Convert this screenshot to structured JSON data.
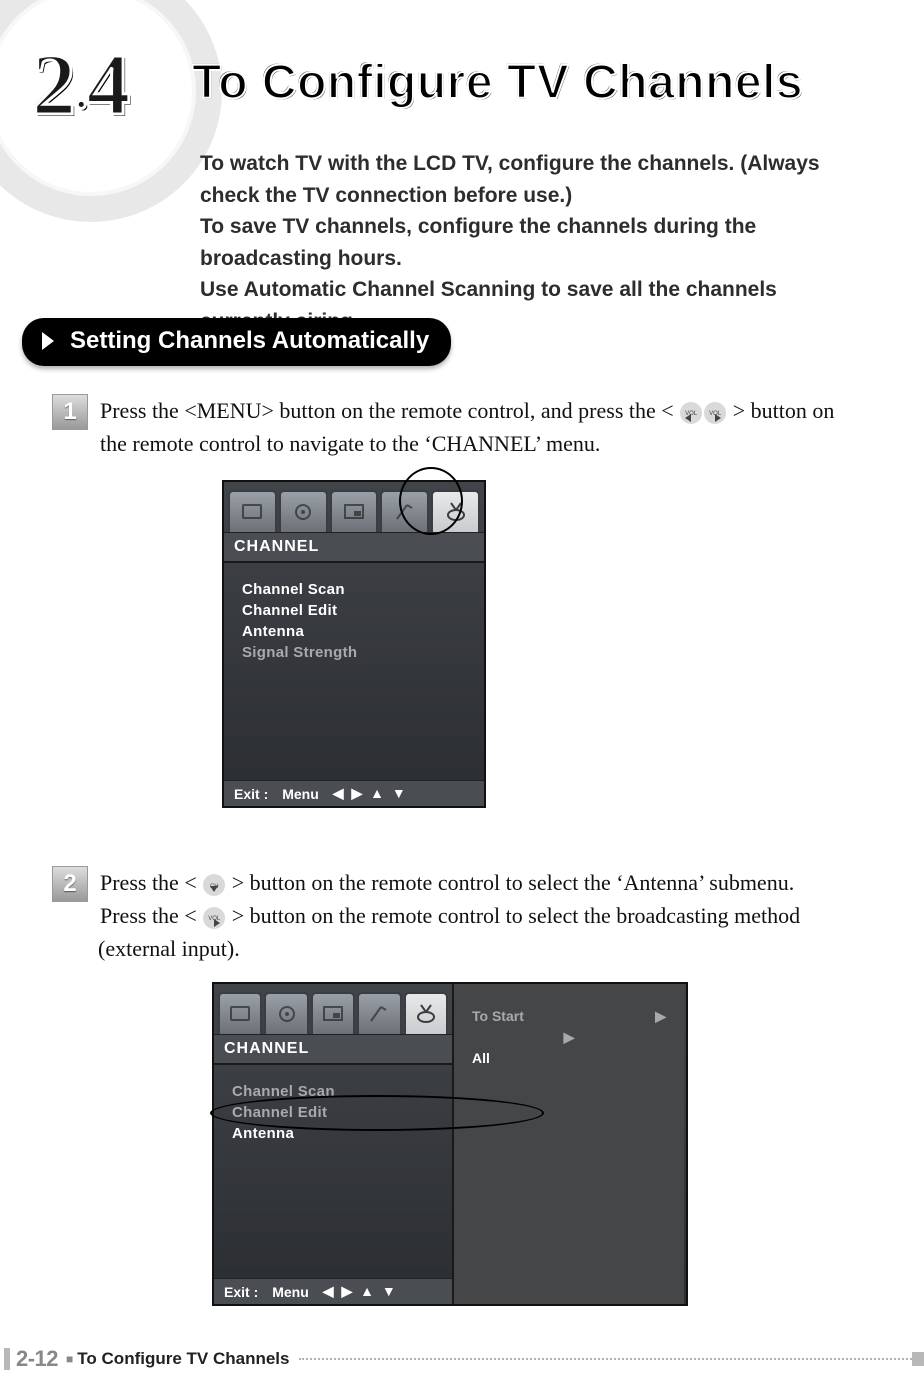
{
  "section_number": "2.4",
  "title": "To Configure TV Channels",
  "intro_line1": "To watch TV with the LCD TV, configure the channels. (Always check the TV connection before use.)",
  "intro_line2": "To save TV channels, configure the channels during the broadcasting hours.",
  "intro_line3": "Use Automatic Channel Scanning to save all the channels currently airing.",
  "subheader": "Setting Channels Automatically",
  "step1": {
    "num": "1",
    "text_a": "Press the <MENU> button on the remote control, and press the <",
    "text_b": "> button on the remote control to navigate to the ‘CHANNEL’ menu."
  },
  "step2": {
    "num": "2",
    "line1_a": "Press the <",
    "line1_b": "> button on the remote control to select the ‘Antenna’ submenu.",
    "line2_a": "Press the <",
    "line2_b": "> button on the remote control to select the broadcasting method (external input)."
  },
  "osd": {
    "header": "CHANNEL",
    "items": [
      "Channel Scan",
      "Channel Edit",
      "Antenna",
      "Signal Strength"
    ],
    "foot_exit": "Exit :",
    "foot_menu": "Menu",
    "foot_arrows": "◀ ▶ ▲ ▼"
  },
  "osd2": {
    "header": "CHANNEL",
    "left_items": [
      "Channel Scan",
      "Channel Edit",
      "Antenna"
    ],
    "right": [
      {
        "label": "To Start",
        "val": "▶"
      },
      {
        "label": "",
        "val": "▶"
      },
      {
        "label": "All",
        "val": ""
      }
    ],
    "foot_exit": "Exit :",
    "foot_menu": "Menu",
    "foot_arrows": "◀ ▶ ▲ ▼"
  },
  "footer": {
    "page": "2-12",
    "title": "To Configure TV Channels"
  }
}
